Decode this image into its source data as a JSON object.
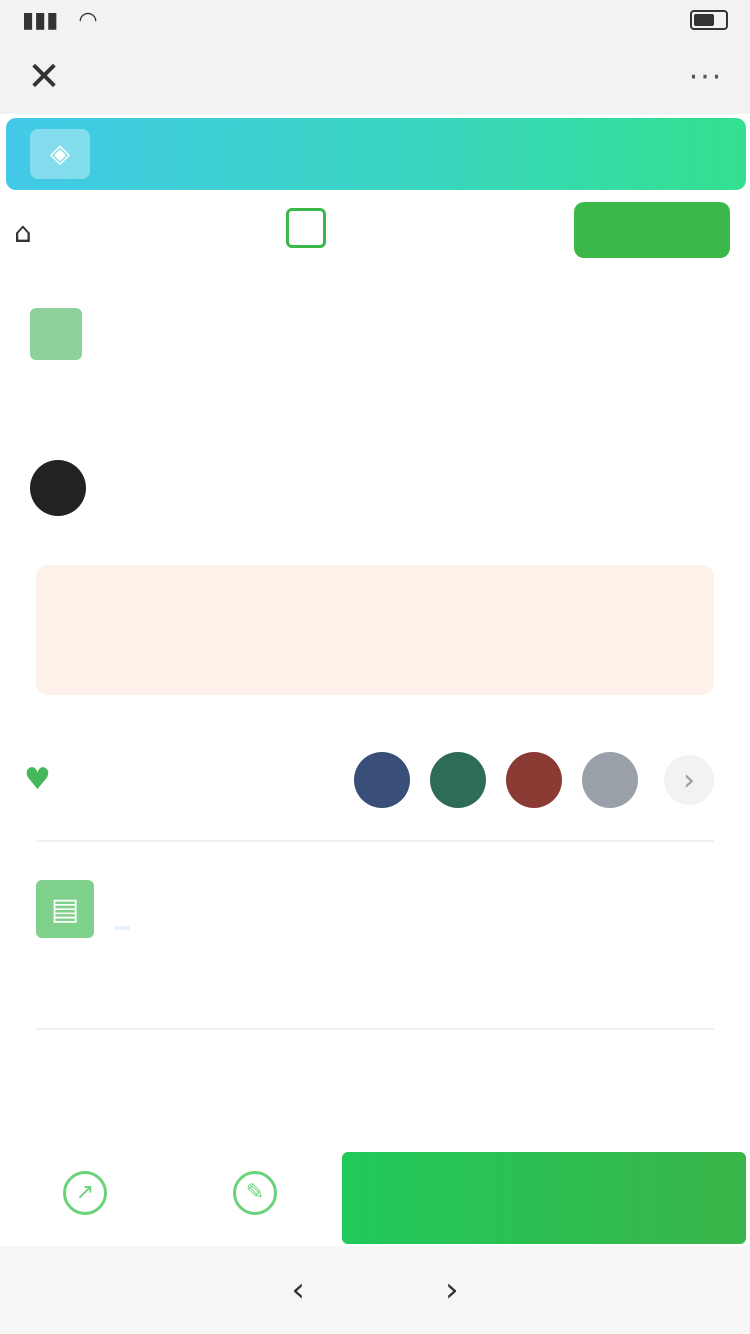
{
  "status_bar": {
    "carrier": "",
    "time": "",
    "battery_text": ""
  },
  "nav": {
    "close_glyph": "✕",
    "title": "",
    "more_glyph": "···"
  },
  "banner": {
    "text": "",
    "link": "",
    "icon": "tag-icon"
  },
  "top": {
    "home_icon": "home-icon",
    "home_label": "",
    "logo_text": "",
    "login_label": ""
  },
  "headline": {
    "text": ""
  },
  "author": {
    "name": ""
  },
  "stats": [
    {
      "value": "",
      "label": ""
    },
    {
      "value": "",
      "label": ""
    },
    {
      "value": "",
      "label": ""
    }
  ],
  "helpers": {
    "label": "",
    "avatar_colors": [
      "#3a4e7a",
      "#2f6b59",
      "#8a3b34",
      "#9aa0a8"
    ],
    "chevron": "›"
  },
  "project": {
    "title": "",
    "tag1": "",
    "tag2": "",
    "tag3": "",
    "description": ""
  },
  "section": {
    "title": ""
  },
  "bottom_bar": {
    "item1_label": "",
    "item2_label": "",
    "cta_label": ""
  },
  "system_nav": {
    "back": "‹",
    "forward": "›"
  },
  "colors": {
    "accent_green": "#3cb84b",
    "stat_orange": "#f47a4c",
    "banner_start": "#42c9e8",
    "banner_end": "#34e08f"
  }
}
